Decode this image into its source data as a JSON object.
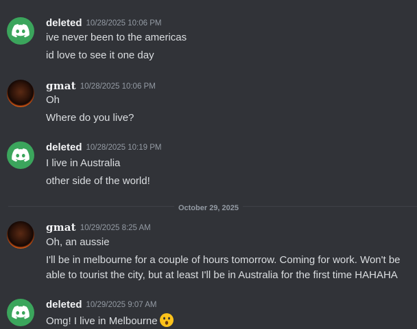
{
  "messages": [
    {
      "username": "deleted",
      "timestamp": "10/28/2025 10:06 PM",
      "avatar": "discord-logo-icon",
      "lines": [
        "ive never been to the americas",
        "id love to see it one day"
      ]
    },
    {
      "username": "gmat",
      "timestamp": "10/28/2025 10:06 PM",
      "avatar": "user-photo",
      "lines": [
        "Oh",
        "Where do you live?"
      ]
    },
    {
      "username": "deleted",
      "timestamp": "10/28/2025 10:19 PM",
      "avatar": "discord-logo-icon",
      "lines": [
        "I live in Australia",
        "other side of the world!"
      ]
    },
    {
      "username": "gmat",
      "timestamp": "10/29/2025 8:25 AM",
      "avatar": "user-photo",
      "lines": [
        "Oh, an aussie",
        "I'll be in melbourne for a couple of hours tomorrow. Coming for work. Won't be able to tourist the city, but at least I'll be in Australia for the first time HAHAHA"
      ]
    },
    {
      "username": "deleted",
      "timestamp": "10/29/2025 9:07 AM",
      "avatar": "discord-logo-icon",
      "lines": [
        "Omg! I live in Melbourne"
      ],
      "emoji": "astonished-face-icon"
    }
  ],
  "date_divider": "October 29, 2025",
  "colors": {
    "background": "#313338",
    "discord_green": "#3ba55c",
    "username": "#f2f3f5",
    "text": "#dbdee1",
    "muted": "#949ba4"
  }
}
